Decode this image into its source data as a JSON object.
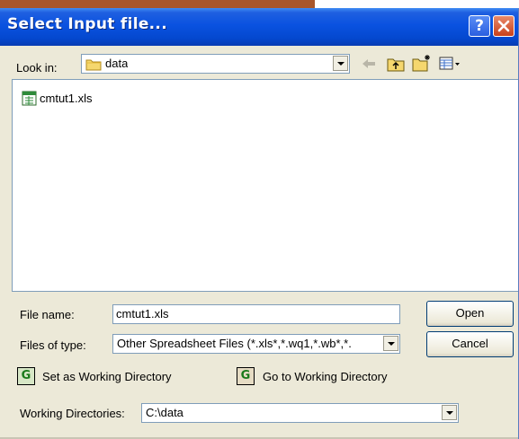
{
  "window": {
    "title": "Select Input file..."
  },
  "look_in": {
    "label": "Look in:",
    "value": "data"
  },
  "files": [
    {
      "name": "cmtut1.xls",
      "icon": "excel-file-icon"
    }
  ],
  "file_name": {
    "label": "File name:",
    "value": "cmtut1.xls"
  },
  "files_of_type": {
    "label": "Files of type:",
    "value": "Other Spreadsheet Files (*.xls*,*.wq1,*.wb*,*."
  },
  "buttons": {
    "open": "Open",
    "cancel": "Cancel"
  },
  "working_dir": {
    "set_label": "Set as Working Directory",
    "goto_label": "Go to Working Directory",
    "label": "Working Directories:",
    "value": "C:\\data"
  },
  "icons": {
    "help": "help-icon",
    "close": "close-icon",
    "back": "back-arrow-icon",
    "up": "up-folder-icon",
    "new_folder": "new-folder-icon",
    "view_menu": "view-menu-icon",
    "folder": "folder-icon",
    "set_wd": "set-working-directory-icon",
    "goto_wd": "go-to-working-directory-icon"
  },
  "colors": {
    "titlebar": "#0a52e0",
    "dialog_bg": "#ece9d8",
    "accent_strip": "#a8562b"
  }
}
